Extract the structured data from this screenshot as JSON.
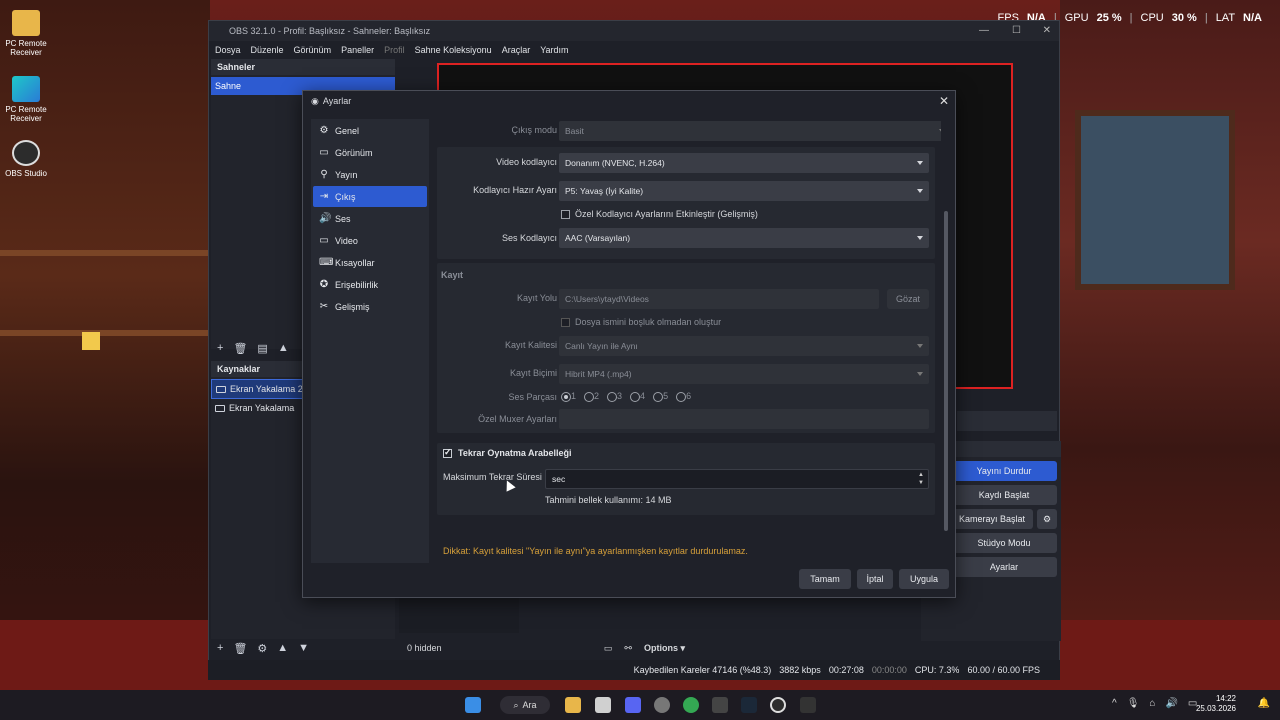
{
  "overlay": {
    "fps_label": "FPS",
    "fps_value": "N/A",
    "gpu_label": "GPU",
    "gpu_value": "25 %",
    "cpu_label": "CPU",
    "cpu_value": "30 %",
    "lat_label": "LAT",
    "lat_value": "N/A"
  },
  "desktop": {
    "icons": [
      {
        "label": "PC Remote Receiver"
      },
      {
        "label": "PC Remote Receiver"
      },
      {
        "label": "OBS Studio"
      }
    ]
  },
  "obs": {
    "title": "OBS 32.1.0 - Profil: Başlıksız - Sahneler: Başlıksız",
    "menu": [
      "Dosya",
      "Düzenle",
      "Görünüm",
      "Paneller",
      "Profil",
      "Sahne Koleksiyonu",
      "Araçlar",
      "Yardım"
    ],
    "scenes_header": "Sahneler",
    "scenes": [
      "Sahne"
    ],
    "sources_header": "Kaynaklar",
    "sources": [
      "Ekran Yakalama 2",
      "Ekran Yakalama"
    ],
    "controls_header": "ller",
    "controls": [
      "Yayını Durdur",
      "Kaydı Başlat",
      "Kamerayı Başlat",
      "Stüdyo Modu",
      "Ayarlar"
    ],
    "hidden_label": "0 hidden",
    "options_label": "Options",
    "status": {
      "dropped": "Kaybedilen Kareler 47146 (%48.3)",
      "kbps": "3882 kbps",
      "stream_time": "00:27:08",
      "rec_time": "00:00:00",
      "cpu": "CPU: 7.3%",
      "fps": "60.00 / 60.00 FPS"
    }
  },
  "dialog": {
    "title": "Ayarlar",
    "sidebar": [
      {
        "label": "Genel",
        "icon": "gear-icon"
      },
      {
        "label": "Görünüm",
        "icon": "display-icon"
      },
      {
        "label": "Yayın",
        "icon": "broadcast-icon"
      },
      {
        "label": "Çıkış",
        "icon": "output-icon",
        "selected": true
      },
      {
        "label": "Ses",
        "icon": "speaker-icon"
      },
      {
        "label": "Video",
        "icon": "monitor-icon"
      },
      {
        "label": "Kısayollar",
        "icon": "keyboard-icon"
      },
      {
        "label": "Erişebilirlik",
        "icon": "accessibility-icon"
      },
      {
        "label": "Gelişmiş",
        "icon": "wrench-icon"
      }
    ],
    "output_mode_label": "Çıkış modu",
    "output_mode_value": "Basit",
    "video_encoder_label": "Video kodlayıcı",
    "video_encoder_value": "Donanım (NVENC, H.264)",
    "preset_label": "Kodlayıcı Hazır Ayarı",
    "preset_value": "P5: Yavaş (İyi Kalite)",
    "custom_encoder_label": "Özel Kodlayıcı Ayarlarını Etkinleştir (Gelişmiş)",
    "audio_encoder_label": "Ses Kodlayıcı",
    "audio_encoder_value": "AAC (Varsayılan)",
    "recording_header": "Kayıt",
    "rec_path_label": "Kayıt Yolu",
    "rec_path_value": "C:\\Users\\ytayd\\Videos",
    "browse_label": "Gözat",
    "no_space_label": "Dosya ismini boşluk olmadan oluştur",
    "rec_quality_label": "Kayıt Kalitesi",
    "rec_quality_value": "Canlı Yayın ile Aynı",
    "rec_format_label": "Kayıt Biçimi",
    "rec_format_value": "Hibrit MP4 (.mp4)",
    "audio_track_label": "Ses Parçası",
    "audio_tracks": [
      "1",
      "2",
      "3",
      "4",
      "5",
      "6"
    ],
    "muxer_label": "Özel Muxer Ayarları",
    "replay_label": "Tekrar Oynatma Arabelleği",
    "max_replay_label": "Maksimum Tekrar Süresi",
    "max_replay_value": "sec",
    "memory_label": "Tahmini bellek kullanımı: 14 MB",
    "warning": "Dikkat: Kayıt kalitesi \"Yayın ile aynı\"ya ayarlanmışken kayıtlar durdurulamaz.",
    "ok_label": "Tamam",
    "cancel_label": "İptal",
    "apply_label": "Uygula"
  },
  "taskbar": {
    "search_label": "Ara",
    "time": "14:22",
    "date": "25.03.2026"
  }
}
